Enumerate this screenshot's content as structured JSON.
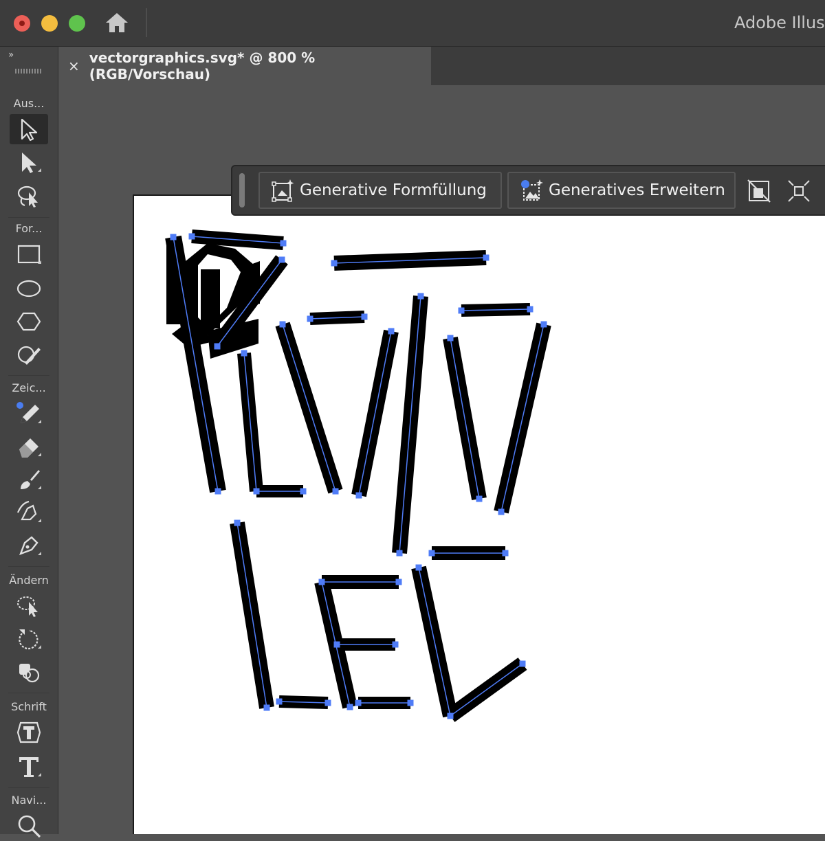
{
  "app": {
    "title": "Adobe Illust"
  },
  "window_controls": [
    "close",
    "minimize",
    "zoom"
  ],
  "titlebar": {
    "home_icon": "home-icon"
  },
  "document_tab": {
    "close_glyph": "×",
    "title": "vectorgraphics.svg* @ 800 % (RGB/Vorschau)"
  },
  "toolbar": {
    "collapse_glyph": "››",
    "sections": {
      "select": "Aus...",
      "shapes": "For...",
      "draw": "Zeic...",
      "modify": "Ändern",
      "type": "Schrift",
      "navigate": "Navi..."
    },
    "tools": [
      "selection-tool",
      "direct-selection-tool",
      "lasso-tool",
      "rectangle-tool",
      "ellipse-tool",
      "polygon-tool",
      "shaper-tool",
      "pencil-tool",
      "eraser-tool",
      "paintbrush-tool",
      "curvature-pen-tool",
      "pen-tool",
      "warp-tool",
      "rotate-tool",
      "shape-builder-tool",
      "type-tool-touch",
      "type-tool",
      "zoom-tool"
    ]
  },
  "contextual_taskbar": {
    "generative_shape_fill": "Generative Formfüllung",
    "generative_expand": "Generatives Erweitern",
    "extra_icons": [
      "mask-off-icon",
      "fit-to-artboard-icon"
    ]
  },
  "colors": {
    "ui_dark": "#3c3c3c",
    "ui_panel": "#434343",
    "canvas_bg": "#535353",
    "artboard": "#ffffff",
    "stroke": "#000000",
    "selection_path": "#4f7cf7",
    "anchor": "#4f7cf7"
  }
}
